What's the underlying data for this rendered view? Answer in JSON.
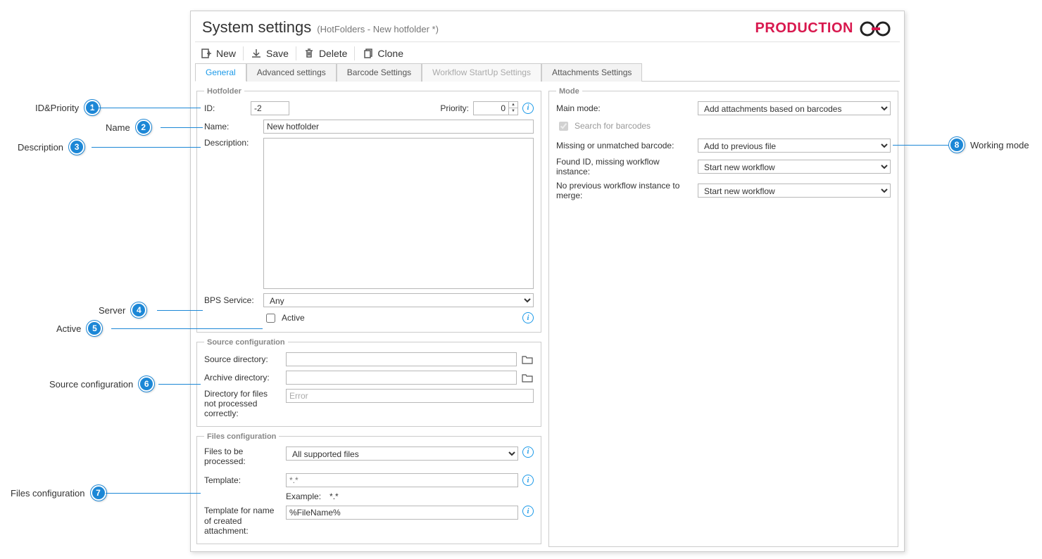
{
  "header": {
    "title": "System settings",
    "sub": "(HotFolders - New hotfolder *)",
    "brand": "PRODUCTION"
  },
  "toolbar": {
    "new": "New",
    "save": "Save",
    "delete": "Delete",
    "clone": "Clone"
  },
  "tabs": {
    "general": "General",
    "advanced": "Advanced settings",
    "barcode": "Barcode Settings",
    "workflow": "Workflow StartUp Settings",
    "attachments": "Attachments Settings"
  },
  "hotfolder": {
    "legend": "Hotfolder",
    "id_label": "ID:",
    "id_value": "-2",
    "priority_label": "Priority:",
    "priority_value": "0",
    "name_label": "Name:",
    "name_value": "New hotfolder",
    "description_label": "Description:",
    "description_value": "",
    "bps_label": "BPS Service:",
    "bps_value": "Any",
    "active_label": "Active"
  },
  "source": {
    "legend": "Source configuration",
    "src_dir_label": "Source directory:",
    "src_dir_value": "",
    "arch_dir_label": "Archive directory:",
    "arch_dir_value": "",
    "err_dir_label": "Directory for files not processed correctly:",
    "err_dir_value": "Error"
  },
  "files": {
    "legend": "Files configuration",
    "proc_label": "Files to be processed:",
    "proc_value": "All supported files",
    "tmpl_label": "Template:",
    "tmpl_placeholder": "*.*",
    "example_label": "Example:",
    "example_value": "*.*",
    "name_tmpl_label": "Template for name of created attachment:",
    "name_tmpl_value": "%FileName%"
  },
  "mode": {
    "legend": "Mode",
    "main_label": "Main mode:",
    "main_value": "Add attachments based on barcodes",
    "search_label": "Search for barcodes",
    "missing_label": "Missing or unmatched barcode:",
    "missing_value": "Add to previous file",
    "found_label": "Found ID, missing workflow instance:",
    "found_value": "Start new workflow",
    "noprev_label": "No previous workflow instance to merge:",
    "noprev_value": "Start new workflow"
  },
  "callouts": {
    "c1": "ID&Priority",
    "c2": "Name",
    "c3": "Description",
    "c4": "Server",
    "c5": "Active",
    "c6": "Source configuration",
    "c7": "Files configuration",
    "c8": "Working mode"
  }
}
